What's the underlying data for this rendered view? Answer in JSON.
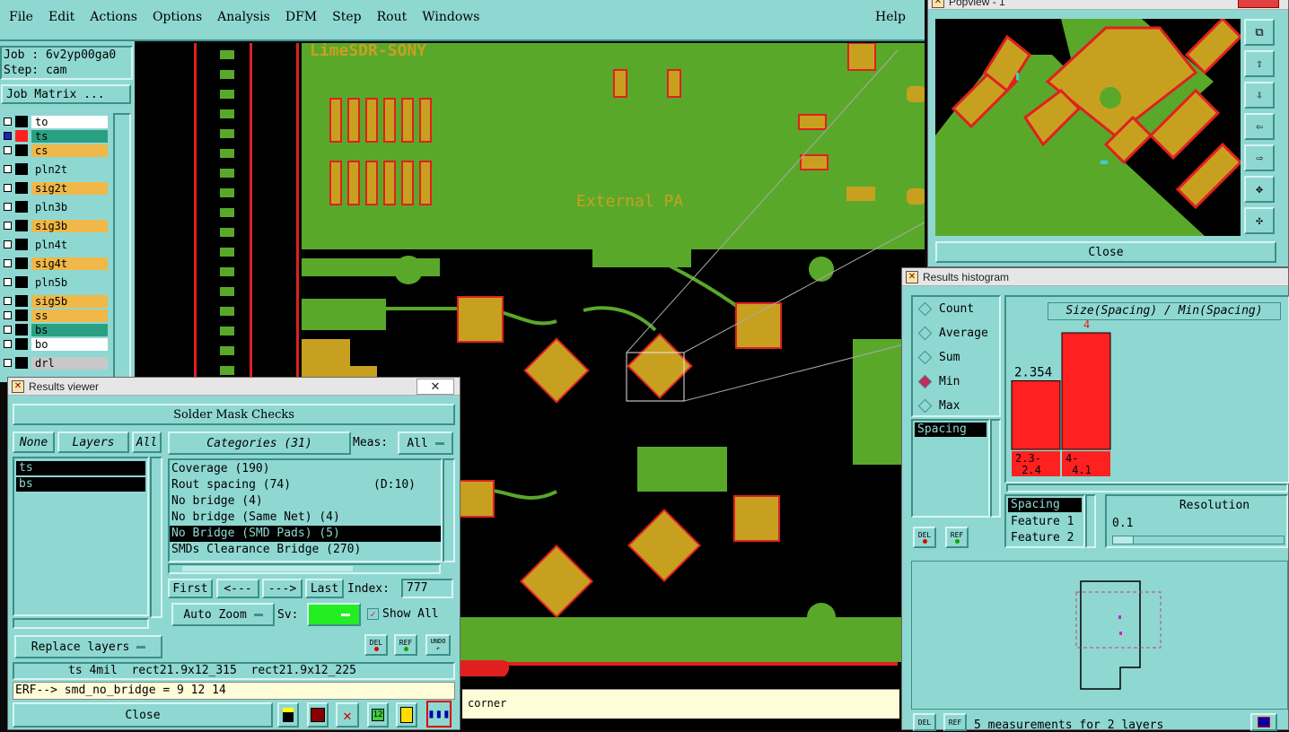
{
  "menu": [
    "File",
    "Edit",
    "Actions",
    "Options",
    "Analysis",
    "DFM",
    "Step",
    "Rout",
    "Windows"
  ],
  "help": "Help",
  "job": {
    "label": "Job :",
    "value": "6v2yp00ga0"
  },
  "step": {
    "label": "Step:",
    "value": "cam"
  },
  "job_matrix": "Job Matrix ...",
  "layers": [
    {
      "name": "to",
      "color": "#ffffff",
      "swatch": "#000000"
    },
    {
      "name": "ts",
      "color": "#2aa082",
      "swatch": "#ff2020"
    },
    {
      "name": "cs",
      "color": "#f0b848",
      "swatch": "#000000"
    },
    {
      "name": "pln2t",
      "color": "#8fd8d2",
      "swatch": "#000000"
    },
    {
      "name": "sig2t",
      "color": "#f0b848",
      "swatch": "#000000"
    },
    {
      "name": "pln3b",
      "color": "#8fd8d2",
      "swatch": "#000000"
    },
    {
      "name": "sig3b",
      "color": "#f0b848",
      "swatch": "#000000"
    },
    {
      "name": "pln4t",
      "color": "#8fd8d2",
      "swatch": "#000000"
    },
    {
      "name": "sig4t",
      "color": "#f0b848",
      "swatch": "#000000"
    },
    {
      "name": "pln5b",
      "color": "#8fd8d2",
      "swatch": "#000000"
    },
    {
      "name": "sig5b",
      "color": "#f0b848",
      "swatch": "#000000"
    },
    {
      "name": "ss",
      "color": "#f0b848",
      "swatch": "#000000"
    },
    {
      "name": "bs",
      "color": "#2aa082",
      "swatch": "#000000"
    },
    {
      "name": "bo",
      "color": "#ffffff",
      "swatch": "#000000"
    },
    {
      "name": "drl",
      "color": "#c8c8c8",
      "swatch": "#000000"
    }
  ],
  "board": {
    "text1": "LimeSDR-SONY",
    "text2": "External PA"
  },
  "results_viewer": {
    "title": "Results viewer",
    "header": "Solder Mask Checks",
    "none": "None",
    "layers": "Layers",
    "all": "All",
    "layer_list": [
      "ts",
      "bs"
    ],
    "categories_label": "Categories (31)",
    "meas_label": "Meas:",
    "meas_value": "All",
    "categories": [
      {
        "text": "Coverage (190)",
        "extra": ""
      },
      {
        "text": "Rout spacing (74)",
        "extra": "(D:10)"
      },
      {
        "text": "No bridge (4)",
        "extra": ""
      },
      {
        "text": "No bridge (Same Net) (4)",
        "extra": ""
      },
      {
        "text": "No Bridge (SMD Pads) (5)",
        "extra": ""
      },
      {
        "text": "SMDs Clearance Bridge (270)",
        "extra": ""
      }
    ],
    "nav": {
      "first": "First",
      "prev": "<---",
      "next": "--->",
      "last": "Last",
      "index_label": "Index:",
      "index_value": "777"
    },
    "auto_zoom": "Auto Zoom",
    "sv_label": "Sv:",
    "show_all": "Show All",
    "replace_layers": "Replace layers",
    "status": "ts 4mil  rect21.9x12_315  rect21.9x12_225",
    "erf": "ERF--> smd_no_bridge = 9 12 14",
    "close": "Close"
  },
  "corner_label": "corner",
  "popview": {
    "title": "Popview - 1",
    "close": "Close"
  },
  "histogram": {
    "title": "Results histogram",
    "modes": [
      {
        "label": "Count",
        "on": false
      },
      {
        "label": "Average",
        "on": false
      },
      {
        "label": "Sum",
        "on": false
      },
      {
        "label": "Min",
        "on": true
      },
      {
        "label": "Max",
        "on": false
      }
    ],
    "chart_title": "Size(Spacing) / Min(Spacing)",
    "list": [
      "Spacing"
    ],
    "chart_data": {
      "type": "bar",
      "categories": [
        "2.3-\n 2.4",
        "4-\n 4.1"
      ],
      "values": [
        2.354,
        4
      ],
      "labels": [
        "2.354",
        "4"
      ]
    },
    "props": [
      "Spacing",
      "Feature 1",
      "Feature 2"
    ],
    "resolution_label": "Resolution",
    "resolution_value": "0.1",
    "footer": "5 measurements for 2 layers"
  },
  "colors": {
    "ui": "#8fd8d2",
    "copper": "#c8a020",
    "plane": "#5aa82a",
    "mask": "#ff2020"
  }
}
